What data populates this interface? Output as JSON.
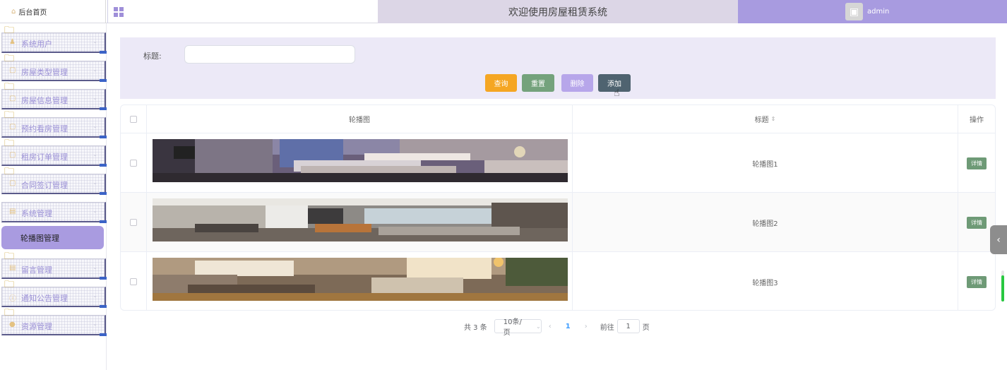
{
  "header": {
    "home_label": "后台首页",
    "system_title": "欢迎使用房屋租赁系统",
    "username": "admin"
  },
  "sidebar": {
    "items": [
      {
        "label": "系统用户",
        "icon": "user-icon"
      },
      {
        "label": "房屋类型管理",
        "icon": "doc-icon"
      },
      {
        "label": "房屋信息管理",
        "icon": "doc-icon"
      },
      {
        "label": "预约看房管理",
        "icon": "doc-icon"
      },
      {
        "label": "租房订单管理",
        "icon": "doc-icon"
      },
      {
        "label": "合同签订管理",
        "icon": "doc-icon"
      },
      {
        "label": "系统管理",
        "icon": "doc-icon"
      },
      {
        "label": "留言管理",
        "icon": "doc-icon"
      },
      {
        "label": "通知公告管理",
        "icon": "info-icon"
      },
      {
        "label": "资源管理",
        "icon": "bulb-icon"
      }
    ],
    "active_item": "轮播图管理"
  },
  "search": {
    "title_label": "标题:",
    "title_value": "",
    "query_label": "查询",
    "reset_label": "重置",
    "delete_label": "删除",
    "add_label": "添加"
  },
  "table": {
    "headers": {
      "image": "轮播图",
      "title": "标题",
      "action": "操作"
    },
    "rows": [
      {
        "title": "轮播图1",
        "action": "详情"
      },
      {
        "title": "轮播图2",
        "action": "详情"
      },
      {
        "title": "轮播图3",
        "action": "详情"
      }
    ]
  },
  "pagination": {
    "total": "共 3 条",
    "page_size": "10条/页",
    "current_page": "1",
    "goto_prefix": "前往",
    "goto_value": "1",
    "goto_suffix": "页"
  },
  "colors": {
    "accent": "#a99be0",
    "query": "#f5a623",
    "reset": "#74a27c",
    "delete": "#b7a6ea",
    "add": "#4f6370",
    "detail": "#6e9a76"
  }
}
